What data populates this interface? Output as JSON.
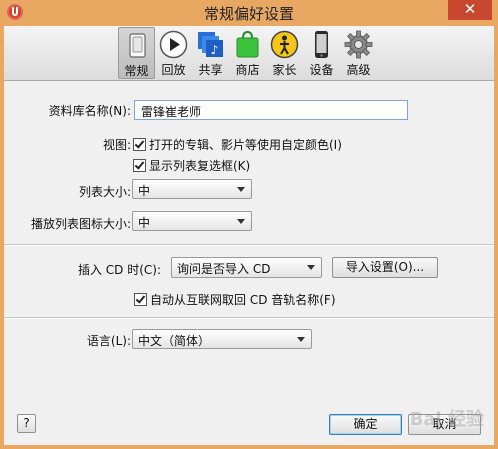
{
  "window": {
    "title": "常规偏好设置",
    "close_glyph": "✕"
  },
  "toolbar": {
    "items": [
      {
        "label": "常规",
        "icon": "general-switch-icon",
        "active": true
      },
      {
        "label": "回放",
        "icon": "play-icon",
        "active": false
      },
      {
        "label": "共享",
        "icon": "share-music-icon",
        "active": false
      },
      {
        "label": "商店",
        "icon": "store-bag-icon",
        "active": false
      },
      {
        "label": "家长",
        "icon": "parental-icon",
        "active": false
      },
      {
        "label": "设备",
        "icon": "device-phone-icon",
        "active": false
      },
      {
        "label": "高级",
        "icon": "gear-icon",
        "active": false
      }
    ]
  },
  "library": {
    "label": "资料库名称(N):",
    "value": "雷锋崔老师"
  },
  "view": {
    "label": "视图:",
    "options": [
      {
        "label": "打开的专辑、影片等使用自定颜色(I)",
        "checked": true
      },
      {
        "label": "显示列表复选框(K)",
        "checked": true
      }
    ]
  },
  "list_size": {
    "label": "列表大小:",
    "value": "中"
  },
  "icon_size": {
    "label": "播放列表图标大小:",
    "value": "中"
  },
  "cd_insert": {
    "label": "插入 CD 时(C):",
    "value": "询问是否导入 CD",
    "import_button": "导入设置(O)...",
    "auto_fetch": {
      "label": "自动从互联网取回 CD 音轨名称(F)",
      "checked": true
    }
  },
  "language": {
    "label": "语言(L):",
    "value": "中文（简体）"
  },
  "footer": {
    "help_label": "?",
    "ok_label": "确定",
    "cancel_label": "取消"
  },
  "watermark": "Bai 经验",
  "colors": {
    "title_bar": "#e8a862",
    "close_button": "#c7482f",
    "focus_border": "#3c7fb1"
  }
}
